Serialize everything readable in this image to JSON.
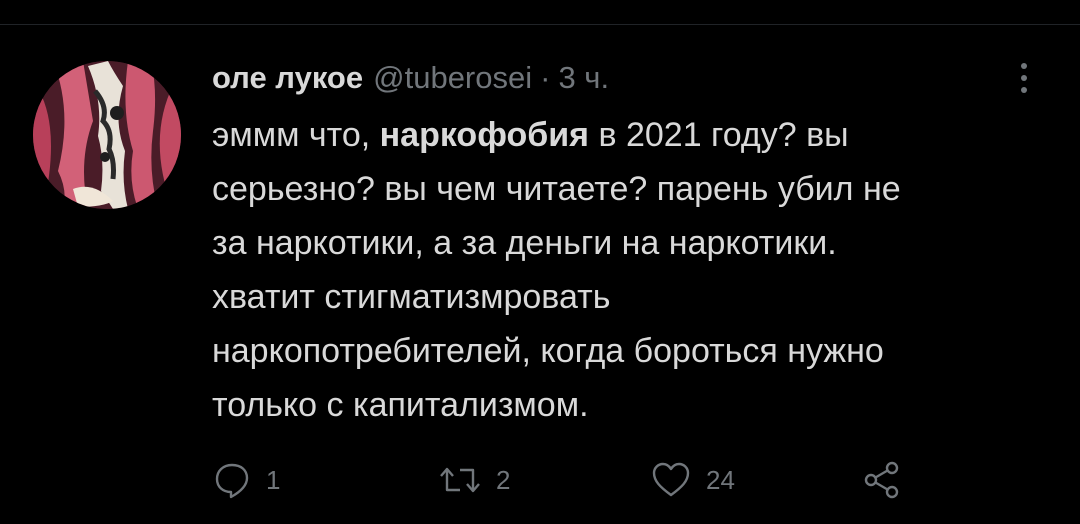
{
  "tweet": {
    "display_name": "оле лукое",
    "handle": "@tuberosei",
    "separator": "·",
    "time": "3 ч.",
    "text": {
      "line1_before": "эммм что, ",
      "line1_bold": "наркофобия",
      "line1_after": " в 2021 году? вы",
      "line2": "серьезно? вы чем читаете? парень убил не",
      "line3": "за наркотики, а за деньги на наркотики.",
      "line4": "хватит стигматизмровать",
      "line5": "наркопотребителей, когда бороться нужно",
      "line6": "только с капитализмом."
    },
    "actions": {
      "reply_count": "1",
      "retweet_count": "2",
      "like_count": "24"
    }
  },
  "icons": {
    "reply": "reply-icon",
    "retweet": "retweet-icon",
    "like": "heart-icon",
    "share": "share-icon",
    "more": "more-vertical-icon"
  },
  "colors": {
    "background": "#000000",
    "text_primary": "#d9d9d9",
    "text_secondary": "#71767b"
  }
}
